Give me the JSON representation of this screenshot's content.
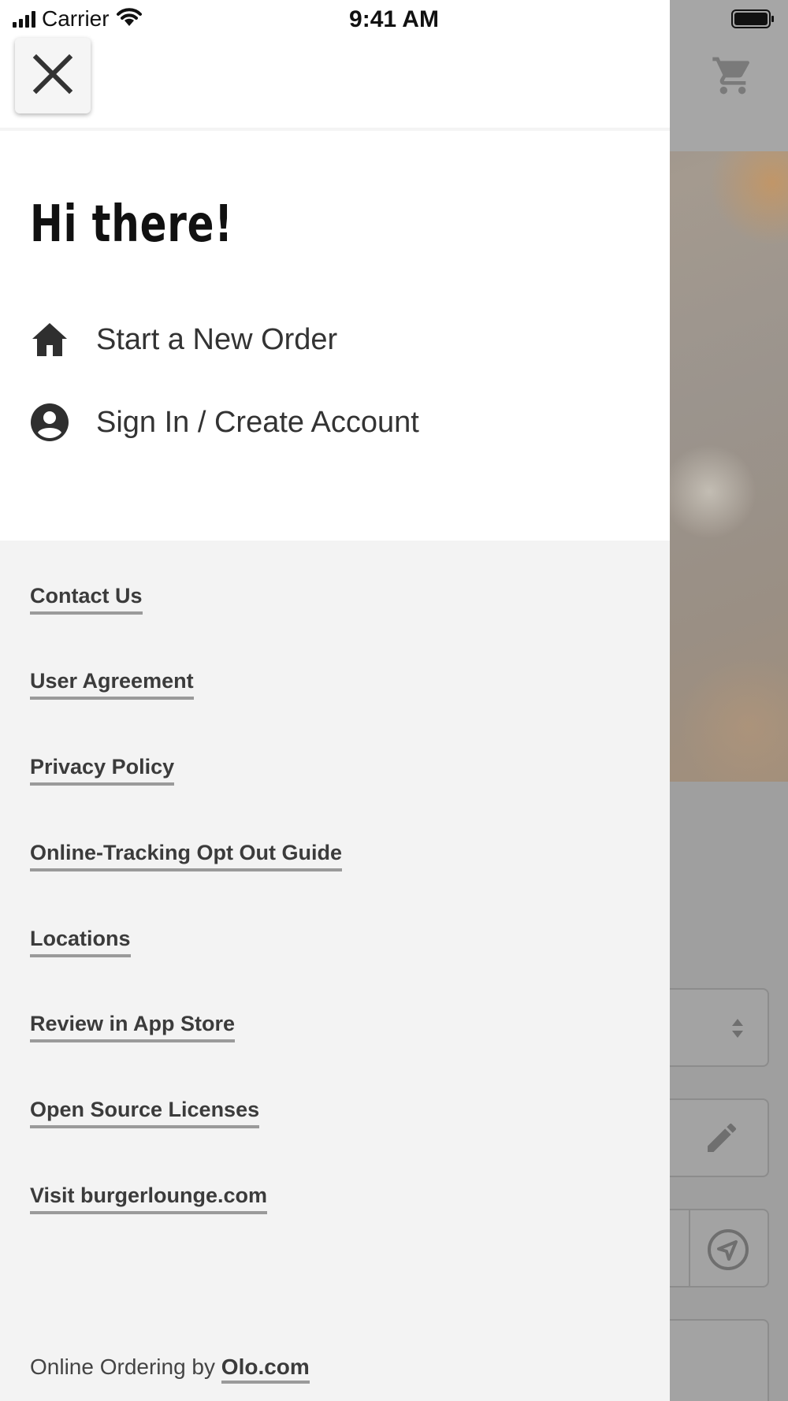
{
  "status_bar": {
    "carrier": "Carrier",
    "time": "9:41 AM"
  },
  "drawer": {
    "greeting": "Hi there!",
    "menu": [
      {
        "label": "Start a New Order",
        "icon": "home-icon"
      },
      {
        "label": "Sign In / Create Account",
        "icon": "account-circle-icon"
      }
    ],
    "links": [
      "Contact Us",
      "User Agreement",
      "Privacy Policy",
      "Online-Tracking Opt Out Guide",
      "Locations",
      "Review in App Store",
      "Open Source Licenses",
      "Visit burgerlounge.com"
    ],
    "footer": {
      "prefix": "Online Ordering by",
      "link": "Olo.com"
    }
  },
  "colors": {
    "drawer_top": "#ffffff",
    "drawer_bottom": "#f3f3f3",
    "text": "#333333",
    "link_underline": "#9a9a9a",
    "overlay": "#a6a6a6"
  }
}
